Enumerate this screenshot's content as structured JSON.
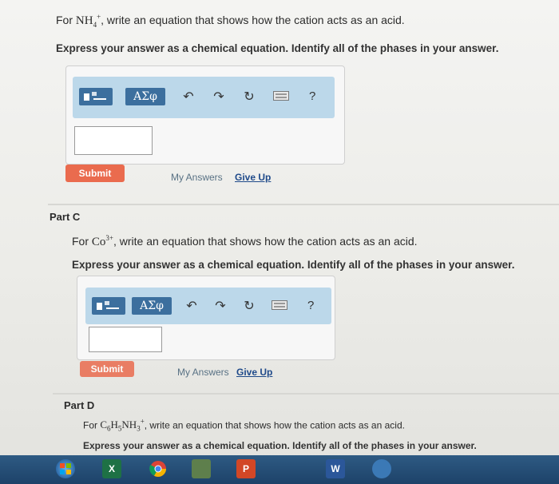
{
  "partB": {
    "q_pre": "For ",
    "chem": "NH",
    "chem_sub": "4",
    "chem_sup": "+",
    "q_post": ", write an equation that shows how the cation acts as an acid.",
    "instruction": "Express your answer as a chemical equation. Identify all of the phases in your answer.",
    "toolbar": {
      "greek_label": "ΑΣφ",
      "help_label": "?"
    },
    "submit_label": "Submit",
    "my_answers_label": "My Answers",
    "give_up_label": "Give Up"
  },
  "partC": {
    "title": "Part C",
    "q_pre": "For ",
    "chem": "Co",
    "chem_sup": "3+",
    "q_post": ", write an equation that shows how the cation acts as an acid.",
    "instruction": "Express your answer as a chemical equation. Identify all of the phases in your answer.",
    "toolbar": {
      "greek_label": "ΑΣφ",
      "help_label": "?"
    },
    "submit_label": "Submit",
    "my_answers_label": "My Answers",
    "give_up_label": "Give Up"
  },
  "partD": {
    "title": "Part D",
    "q_pre": "For ",
    "chem_c": "C",
    "chem_c_sub": "6",
    "chem_h": "H",
    "chem_h_sub": "5",
    "chem_nh": "NH",
    "chem_nh_sub": "3",
    "chem_sup": "+",
    "q_post": ", write an equation that shows how the cation acts as an acid.",
    "instruction": "Express your answer as a chemical equation. Identify all of the phases in your answer."
  },
  "taskbar": {
    "icons": [
      "windows-start-icon",
      "excel-icon",
      "chrome-icon",
      "app-icon",
      "powerpoint-icon",
      "word-icon",
      "app-icon-2"
    ],
    "excel_label": "X",
    "powerpoint_label": "P",
    "word_label": "W"
  },
  "colors": {
    "toolbar_bg": "#bcd8ea",
    "button_dark": "#3c6f9e",
    "submit": "#ea6b4e",
    "link": "#1f4a8a",
    "taskbar": "#1d4269"
  }
}
